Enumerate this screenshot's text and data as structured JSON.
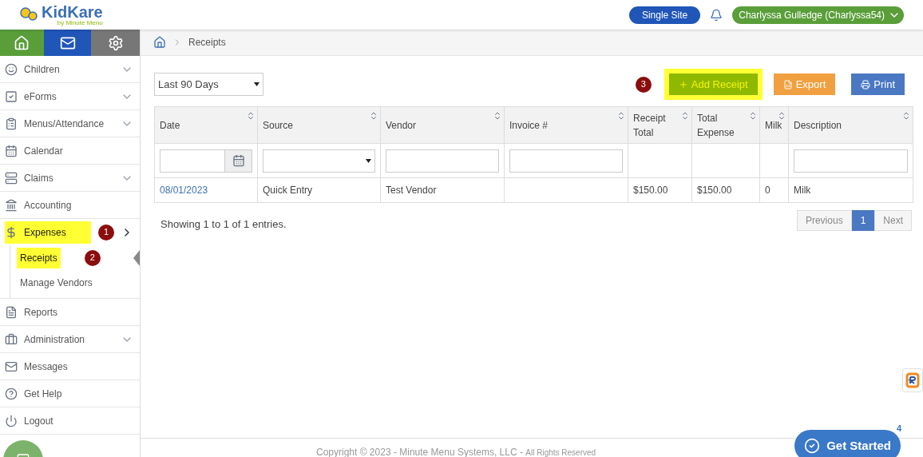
{
  "logo": {
    "name": "KidKare",
    "tagline": "by Minute Menu"
  },
  "header": {
    "site_button": "Single Site",
    "user_menu": "Charlyssa Gulledge (Charlyssa54)"
  },
  "sidebar": {
    "items": [
      {
        "label": "Children",
        "expanded": false,
        "highlighted": false
      },
      {
        "label": "eForms",
        "expanded": false,
        "highlighted": false
      },
      {
        "label": "Menus/Attendance",
        "expanded": false,
        "highlighted": false
      },
      {
        "label": "Calendar",
        "highlighted": false
      },
      {
        "label": "Claims",
        "expanded": false,
        "highlighted": false
      },
      {
        "label": "Accounting",
        "highlighted": false
      },
      {
        "label": "Expenses",
        "expanded": true,
        "highlighted": true,
        "step": "1",
        "children": [
          {
            "label": "Receipts",
            "highlighted": true,
            "selected": true,
            "step": "2"
          },
          {
            "label": "Manage Vendors",
            "highlighted": false,
            "selected": false
          }
        ]
      },
      {
        "label": "Reports",
        "highlighted": false
      },
      {
        "label": "Administration",
        "expanded": false,
        "highlighted": false
      },
      {
        "label": "Messages",
        "highlighted": false
      },
      {
        "label": "Get Help",
        "highlighted": false
      },
      {
        "label": "Logout",
        "highlighted": false
      }
    ]
  },
  "breadcrumb": [
    "Receipts"
  ],
  "range_select": {
    "value": "Last 90 Days"
  },
  "actions": [
    {
      "kind": "add",
      "label": "Add Receipt",
      "highlighted": true,
      "step": "3"
    },
    {
      "kind": "export",
      "label": "Export",
      "highlighted": false
    },
    {
      "kind": "print",
      "label": "Print",
      "highlighted": false
    }
  ],
  "table": {
    "columns": [
      "Date",
      "Source",
      "Vendor",
      "Invoice #",
      "Receipt Total",
      "Total Expense",
      "Milk",
      "Description"
    ],
    "filters": [
      {
        "kind": "date"
      },
      {
        "kind": "select"
      },
      {
        "kind": "text"
      },
      {
        "kind": "text"
      },
      {
        "kind": "empty"
      },
      {
        "kind": "empty"
      },
      {
        "kind": "empty"
      },
      {
        "kind": "text"
      }
    ],
    "rows": [
      {
        "cells": [
          "08/01/2023",
          "Quick Entry",
          "Test Vendor",
          "",
          "$150.00",
          "$150.00",
          "0",
          "Milk"
        ]
      }
    ]
  },
  "entries_info": "Showing 1 to 1 of 1 entries.",
  "pagination": [
    {
      "label": "Previous",
      "selected": false,
      "disabled": true
    },
    {
      "label": "1",
      "selected": true,
      "disabled": false
    },
    {
      "label": "Next",
      "selected": false,
      "disabled": true
    }
  ],
  "footer": {
    "copyright": "Copyright © 2023 - Minute Menu Systems, LLC -",
    "rights": "All Rights Reserved"
  },
  "get_started": {
    "label": "Get Started",
    "badge": "4"
  }
}
